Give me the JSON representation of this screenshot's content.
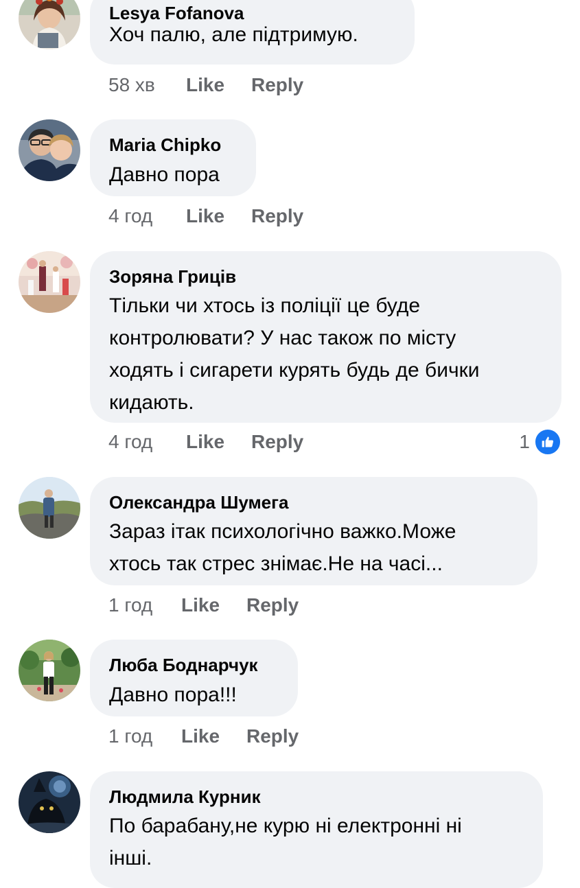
{
  "colors": {
    "bubble": "#f0f2f5",
    "meta_text": "#65676b",
    "like_badge": "#1877f2"
  },
  "actions": {
    "like_label": "Like",
    "reply_label": "Reply"
  },
  "comments": [
    {
      "author": "Lesya  Fofanova",
      "text": "Хоч палю, але підтримую.",
      "time": "58 хв",
      "avatar_icon": "user-avatar-photo"
    },
    {
      "author": "Maria Chipko",
      "text": "Давно пора",
      "time": "4 год",
      "avatar_icon": "user-avatar-photo"
    },
    {
      "author": "Зоряна Гриців",
      "text": "Тільки чи хтось із поліції це буде\nконтролювати? У нас також по місту\nходять і сигарети курять будь де бички\nкидають.",
      "time": "4 год",
      "reaction_count": "1",
      "reaction_icon": "like-reaction-icon",
      "avatar_icon": "user-avatar-photo"
    },
    {
      "author": "Олександра Шумега",
      "text": "Зараз ітак психологічно важко.Може\nхтось так стрес знімає.Не на часі...",
      "time": "1 год",
      "avatar_icon": "user-avatar-photo"
    },
    {
      "author": "Люба Боднарчук",
      "text": "Давно пора!!!",
      "time": "1 год",
      "avatar_icon": "user-avatar-photo"
    },
    {
      "author": "Людмила Курник",
      "text": "По барабану,не курю ні електронні ні\nінші.",
      "time": "",
      "avatar_icon": "user-avatar-photo"
    }
  ]
}
